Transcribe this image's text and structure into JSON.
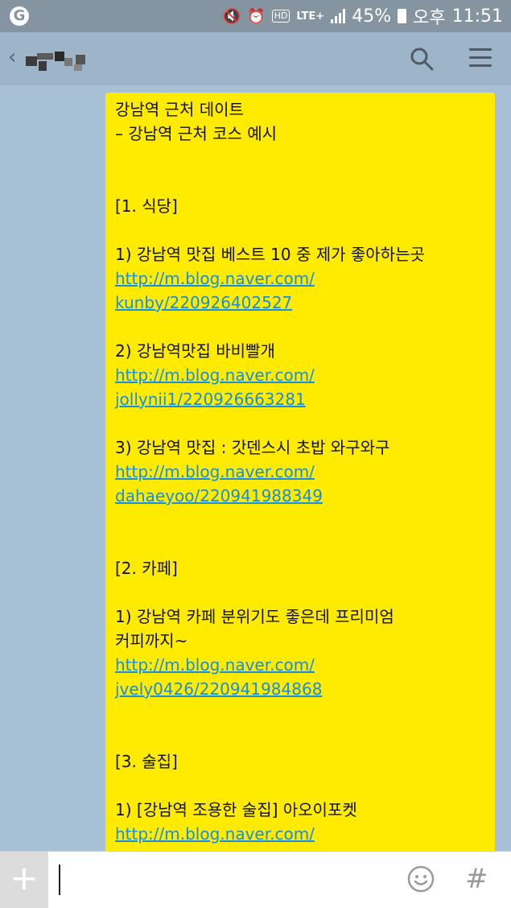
{
  "status_bar": {
    "carrier_icon": "G",
    "lte": "LTE+",
    "battery": "45%",
    "ampm": "오후",
    "time": "11:51"
  },
  "header": {
    "icons": [
      "back-icon",
      "search-icon",
      "menu-icon"
    ]
  },
  "message": {
    "lines": [
      {
        "text": "강남역 근처 데이트"
      },
      {
        "text": "– 강남역 근처 코스 예시"
      },
      {
        "text": ""
      },
      {
        "text": ""
      },
      {
        "text": "[1. 식당]"
      },
      {
        "text": ""
      },
      {
        "text": "1) 강남역 맛집 베스트 10 중 제가 좋아하는곳"
      },
      {
        "text": "http://m.blog.naver.com/",
        "link": true
      },
      {
        "text": "kunby/220926402527",
        "link": true
      },
      {
        "text": ""
      },
      {
        "text": "2) 강남역맛집 바비빨개"
      },
      {
        "text": "http://m.blog.naver.com/",
        "link": true
      },
      {
        "text": "jollynii1/220926663281",
        "link": true
      },
      {
        "text": ""
      },
      {
        "text": "3) 강남역 맛집 : 갓덴스시 초밥 와구와구"
      },
      {
        "text": "http://m.blog.naver.com/",
        "link": true
      },
      {
        "text": "dahaeyoo/220941988349",
        "link": true
      },
      {
        "text": ""
      },
      {
        "text": ""
      },
      {
        "text": "[2. 카페]"
      },
      {
        "text": ""
      },
      {
        "text": "1) 강남역 카페 분위기도 좋은데 프리미엄"
      },
      {
        "text": "커피까지~"
      },
      {
        "text": "http://m.blog.naver.com/",
        "link": true
      },
      {
        "text": "jvely0426/220941984868",
        "link": true
      },
      {
        "text": ""
      },
      {
        "text": ""
      },
      {
        "text": "[3. 술집]"
      },
      {
        "text": ""
      },
      {
        "text": "1) [강남역 조용한 술집] 아오이포켓"
      },
      {
        "text": "http://m.blog.naver.com/",
        "link": true
      }
    ]
  },
  "input_bar": {
    "plus": "+",
    "hash": "#"
  },
  "colors": {
    "chat_background": "#a8c0d6",
    "bubble": "#ffeb00",
    "link": "#1a8fd8",
    "status_bar": "#8494a0"
  }
}
